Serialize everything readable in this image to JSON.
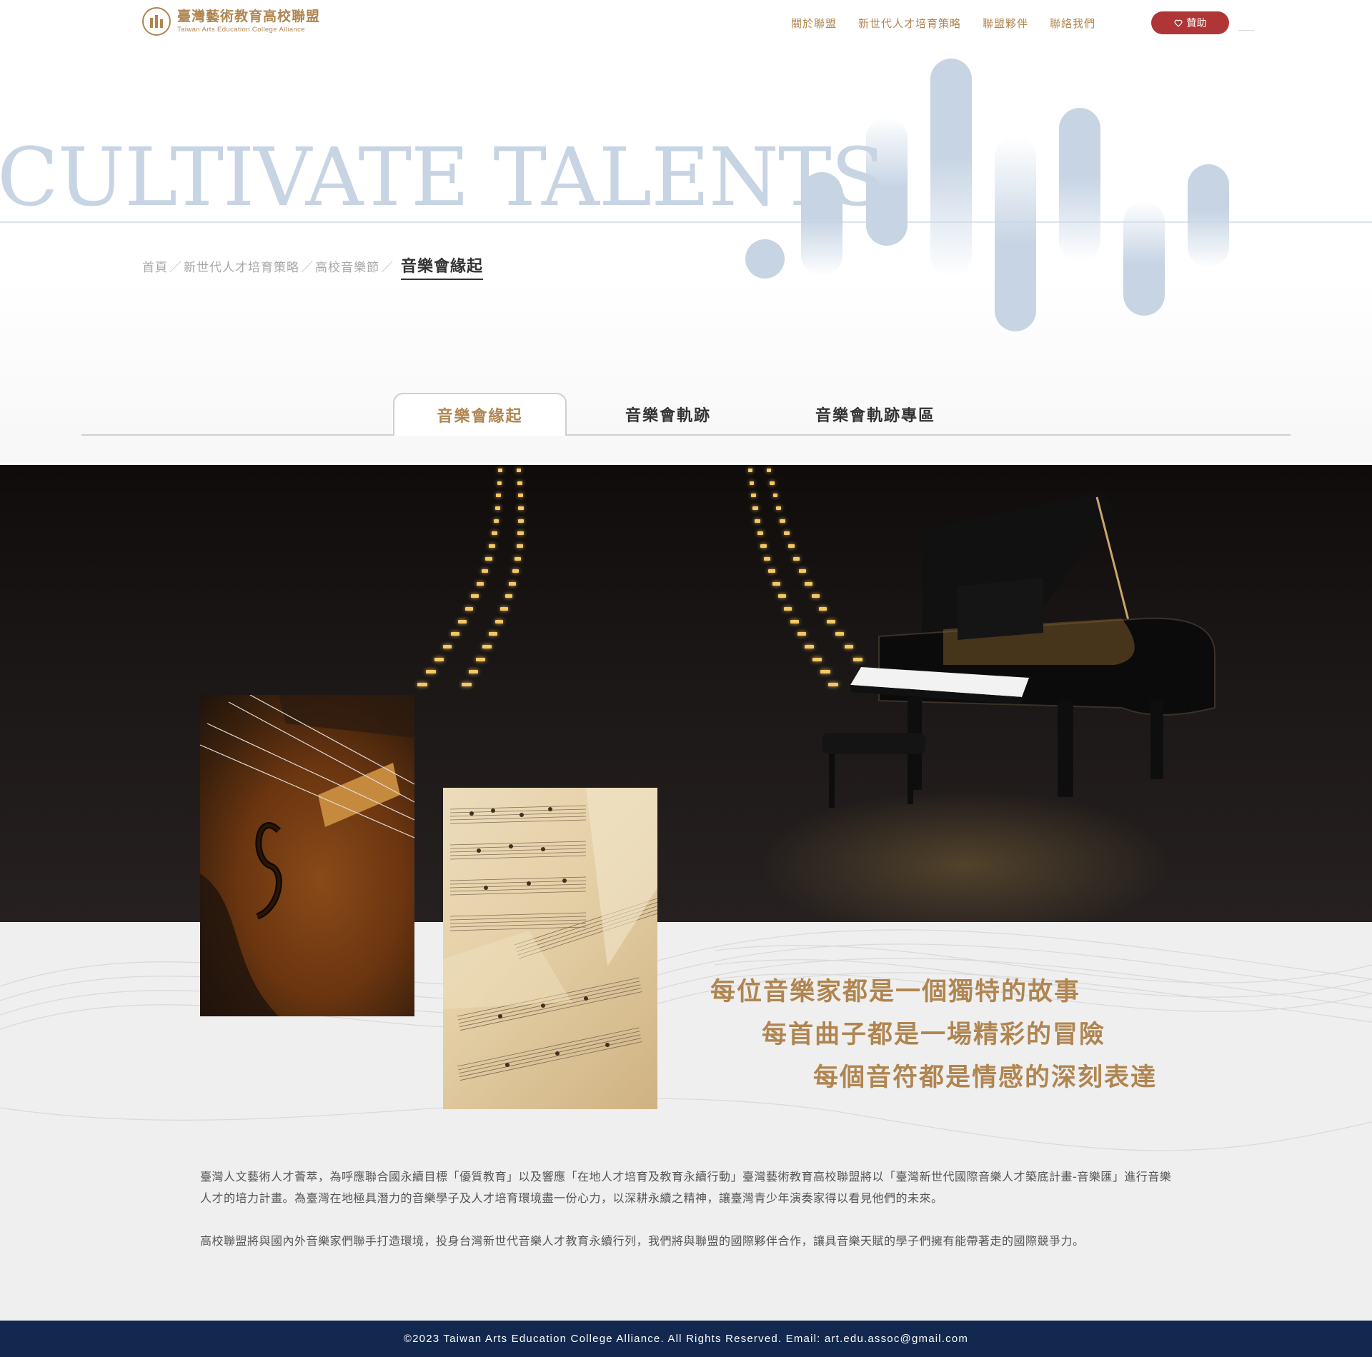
{
  "brand": {
    "name_zh": "臺灣藝術教育高校聯盟",
    "name_en": "Taiwan Arts Education College Alliance",
    "accent_color": "#b08550"
  },
  "nav": {
    "items": [
      "關於聯盟",
      "新世代人才培育策略",
      "聯盟夥伴",
      "聯絡我們"
    ],
    "donate_label": "贊助",
    "donate_icon": "heart-icon",
    "donate_color": "#b03536"
  },
  "hero": {
    "title": "CULTIVATE TALENTS",
    "title_color": "#c7d4e3"
  },
  "breadcrumb": {
    "items": [
      "首頁",
      "新世代人才培育策略",
      "高校音樂節"
    ],
    "separator": "／",
    "current": "音樂會緣起"
  },
  "tabs": [
    "音樂會緣起",
    "音樂會軌跡",
    "音樂會軌跡專區"
  ],
  "taglines": [
    "每位音樂家都是一個獨特的故事",
    "每首曲子都是一場精彩的冒險",
    "每個音符都是情感的深刻表達"
  ],
  "paragraphs": [
    "臺灣人文藝術人才薈萃，為呼應聯合國永續目標「優質教育」以及響應「在地人才培育及教育永續行動」臺灣藝術教育高校聯盟將以「臺灣新世代國際音樂人才築底計畫-音樂匯」進行音樂人才的培力計畫。為臺灣在地極具潛力的音樂學子及人才培育環境盡一份心力，以深耕永續之精神，讓臺灣青少年演奏家得以看見他們的未來。",
    "高校聯盟將與國內外音樂家們聯手打造環境，投身台灣新世代音樂人才教育永續行列，我們將與聯盟的國際夥伴合作，讓具音樂天賦的學子們擁有能帶著走的國際競爭力。"
  ],
  "footer": {
    "text": "©2023 Taiwan Arts Education College Alliance. All Rights Reserved. Email: art.edu.assoc@gmail.com",
    "background": "#12284e"
  }
}
